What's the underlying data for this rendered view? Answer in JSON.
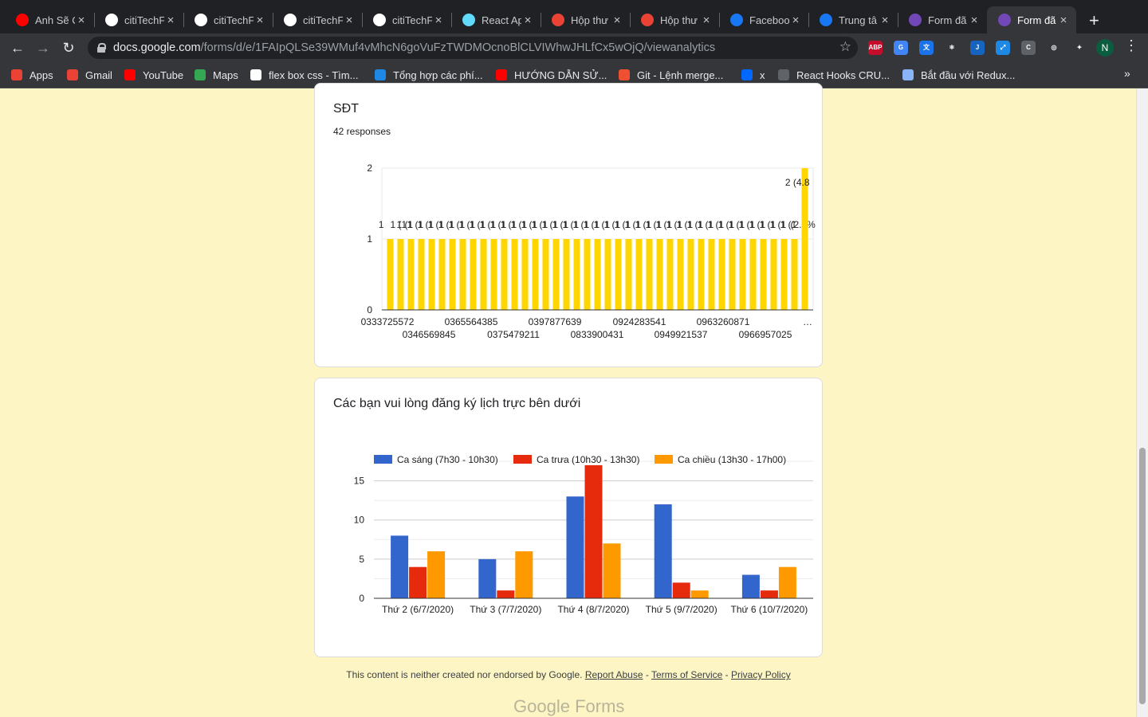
{
  "browser": {
    "tabs": [
      {
        "title": "Anh Sẽ C",
        "icon": "youtube-icon",
        "color": "#ff0000"
      },
      {
        "title": "citiTechF",
        "icon": "github-icon",
        "color": "#ffffff"
      },
      {
        "title": "citiTechF",
        "icon": "github-icon",
        "color": "#ffffff"
      },
      {
        "title": "citiTechF",
        "icon": "github-icon",
        "color": "#ffffff"
      },
      {
        "title": "citiTechF",
        "icon": "github-icon",
        "color": "#ffffff"
      },
      {
        "title": "React Ap",
        "icon": "react-icon",
        "color": "#61dafb"
      },
      {
        "title": "Hộp thư",
        "icon": "gmail-icon",
        "color": "#ea4335"
      },
      {
        "title": "Hộp thư",
        "icon": "gmail-icon",
        "color": "#ea4335"
      },
      {
        "title": "Faceboo",
        "icon": "facebook-icon",
        "color": "#1877f2"
      },
      {
        "title": "Trung tâ",
        "icon": "facebook-icon",
        "color": "#1877f2"
      },
      {
        "title": "Form đã",
        "icon": "google-forms-icon",
        "color": "#7248b9"
      },
      {
        "title": "Form đã",
        "icon": "google-forms-icon",
        "color": "#7248b9"
      }
    ],
    "active_tab_index": 11,
    "url_host": "docs.google.com",
    "url_path": "/forms/d/e/1FAIpQLSe39WMuf4vMhcN6goVuFzTWDMOcnoBlCLVIWhwJHLfCx5wOjQ/viewanalytics",
    "avatar_letter": "N",
    "extensions": [
      {
        "label": "ABP",
        "color": "#c70d2c"
      },
      {
        "label": "G",
        "color": "#4285f4"
      },
      {
        "label": "文",
        "color": "#1a73e8"
      },
      {
        "label": "⚛",
        "color": "#35363a"
      },
      {
        "label": "J",
        "color": "#1565c0"
      },
      {
        "label": "⤢",
        "color": "#1e88e5"
      },
      {
        "label": "C",
        "color": "#5f6368"
      },
      {
        "label": "◎",
        "color": "#35363a"
      },
      {
        "label": "✦",
        "color": "#35363a"
      }
    ],
    "bookmarks": [
      {
        "label": "Apps",
        "icon": "apps-grid-icon",
        "color": "#ea4335"
      },
      {
        "label": "Gmail",
        "icon": "gmail-icon",
        "color": "#ea4335"
      },
      {
        "label": "YouTube",
        "icon": "youtube-icon",
        "color": "#ff0000"
      },
      {
        "label": "Maps",
        "icon": "maps-icon",
        "color": "#34a853"
      },
      {
        "label": "flex box css - Tìm...",
        "icon": "google-icon",
        "color": "#ffffff"
      },
      {
        "label": "Tổng hợp các phí...",
        "icon": "site-icon",
        "color": "#1e88e5"
      },
      {
        "label": "HƯỚNG DẪN SỬ...",
        "icon": "youtube-icon",
        "color": "#ff0000"
      },
      {
        "label": "Git - Lệnh merge...",
        "icon": "git-icon",
        "color": "#f05032"
      },
      {
        "label": "x",
        "icon": "zalo-icon",
        "color": "#0068ff"
      },
      {
        "label": "React Hooks CRU...",
        "icon": "code-icon",
        "color": "#5f6368"
      },
      {
        "label": "Bắt đầu với Redux...",
        "icon": "v-icon",
        "color": "#8ab4f8"
      }
    ]
  },
  "phone_question": {
    "title": "SĐT",
    "responses": "42 responses",
    "chart_data": {
      "type": "bar",
      "title": "",
      "ylim": [
        0,
        2
      ],
      "y_ticks": [
        "0",
        "1",
        "2"
      ],
      "values": [
        1,
        1,
        1,
        1,
        1,
        1,
        1,
        1,
        1,
        1,
        1,
        1,
        1,
        1,
        1,
        1,
        1,
        1,
        1,
        1,
        1,
        1,
        1,
        1,
        1,
        1,
        1,
        1,
        1,
        1,
        1,
        1,
        1,
        1,
        1,
        1,
        1,
        1,
        1,
        1,
        2
      ],
      "bar_color": "#ffd600",
      "bar_labels_repeated": "1 (1",
      "last_bar_label": "2 (4.8",
      "second_last_bar_label": "(2.4%",
      "first_bar_label": "1",
      "x_labels_row1": [
        "0333725572",
        "0365564385",
        "0397877639",
        "0924283541",
        "0963260871",
        "…"
      ],
      "x_labels_row2": [
        "0346569845",
        "0375479211",
        "0833900431",
        "0949921537",
        "0966957025"
      ]
    }
  },
  "schedule_question": {
    "title": "Các bạn vui lòng đăng ký lịch trực bên dưới",
    "chart_data": {
      "type": "bar",
      "categories": [
        "Thứ 2 (6/7/2020)",
        "Thứ 3 (7/7/2020)",
        "Thứ 4 (8/7/2020)",
        "Thứ 5 (9/7/2020)",
        "Thứ 6 (10/7/2020)"
      ],
      "series": [
        {
          "name": "Ca sáng (7h30 - 10h30)",
          "color": "#3366cc",
          "values": [
            8,
            5,
            13,
            12,
            3
          ]
        },
        {
          "name": "Ca trưa (10h30 - 13h30)",
          "color": "#e62a0c",
          "values": [
            4,
            1,
            17,
            2,
            1
          ]
        },
        {
          "name": "Ca chiều (13h30 - 17h00)",
          "color": "#ff9900",
          "values": [
            6,
            6,
            7,
            1,
            4
          ]
        }
      ],
      "ylim": [
        0,
        17.5
      ],
      "y_ticks": [
        0,
        5,
        10,
        15
      ],
      "legend": "top"
    }
  },
  "footer": {
    "disclaimer": "This content is neither created nor endorsed by Google.",
    "report_abuse": "Report Abuse",
    "sep1": " - ",
    "terms": "Terms of Service",
    "sep2": " - ",
    "privacy": "Privacy Policy",
    "logo_google": "Google",
    "logo_forms": "Forms"
  }
}
